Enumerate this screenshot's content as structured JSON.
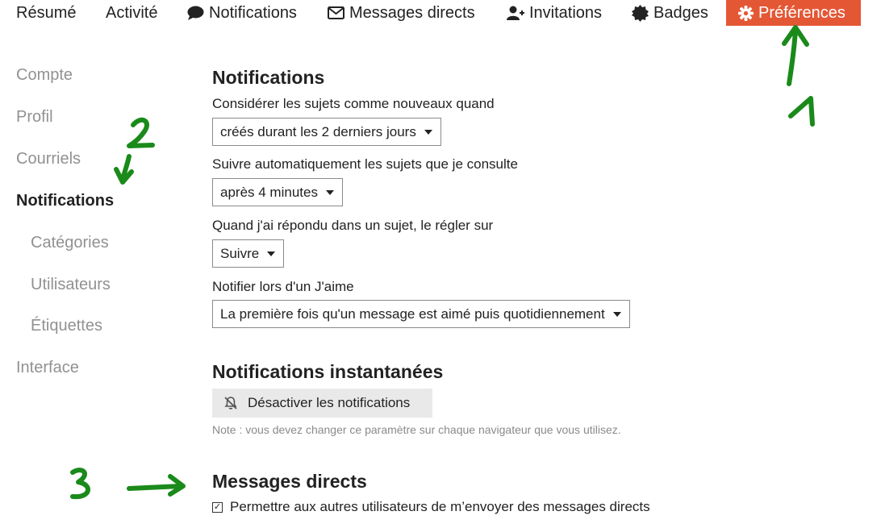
{
  "nav": {
    "summary": "Résumé",
    "activity": "Activité",
    "notifications": "Notifications",
    "messages": "Messages directs",
    "invites": "Invitations",
    "badges": "Badges",
    "preferences": "Préférences"
  },
  "sidebar": {
    "items": [
      {
        "label": "Compte"
      },
      {
        "label": "Profil"
      },
      {
        "label": "Courriels"
      },
      {
        "label": "Notifications"
      },
      {
        "label": "Catégories"
      },
      {
        "label": "Utilisateurs"
      },
      {
        "label": "Étiquettes"
      },
      {
        "label": "Interface"
      }
    ]
  },
  "notifications": {
    "heading": "Notifications",
    "new_topics_label": "Considérer les sujets comme nouveaux quand",
    "new_topics_value": "créés durant les 2 derniers jours",
    "auto_track_label": "Suivre automatiquement les sujets que je consulte",
    "auto_track_value": "après 4 minutes",
    "replied_label": "Quand j'ai répondu dans un sujet, le régler sur",
    "replied_value": "Suivre",
    "like_label": "Notifier lors d'un J'aime",
    "like_value": "La première fois qu'un message est aimé puis quotidiennement"
  },
  "push": {
    "heading": "Notifications instantanées",
    "button_label": "Désactiver les notifications",
    "note": "Note : vous devez changer ce paramètre sur chaque navigateur que vous utilisez."
  },
  "pm": {
    "heading": "Messages directs",
    "allow_label": "Permettre aux autres utilisateurs de m’envoyer des messages directs",
    "allow_checked": true
  },
  "annotations": {
    "color": "#1a8a1a",
    "marks": [
      "1",
      "2",
      "3"
    ]
  },
  "colors": {
    "accent": "#e45735",
    "muted": "#919191"
  }
}
